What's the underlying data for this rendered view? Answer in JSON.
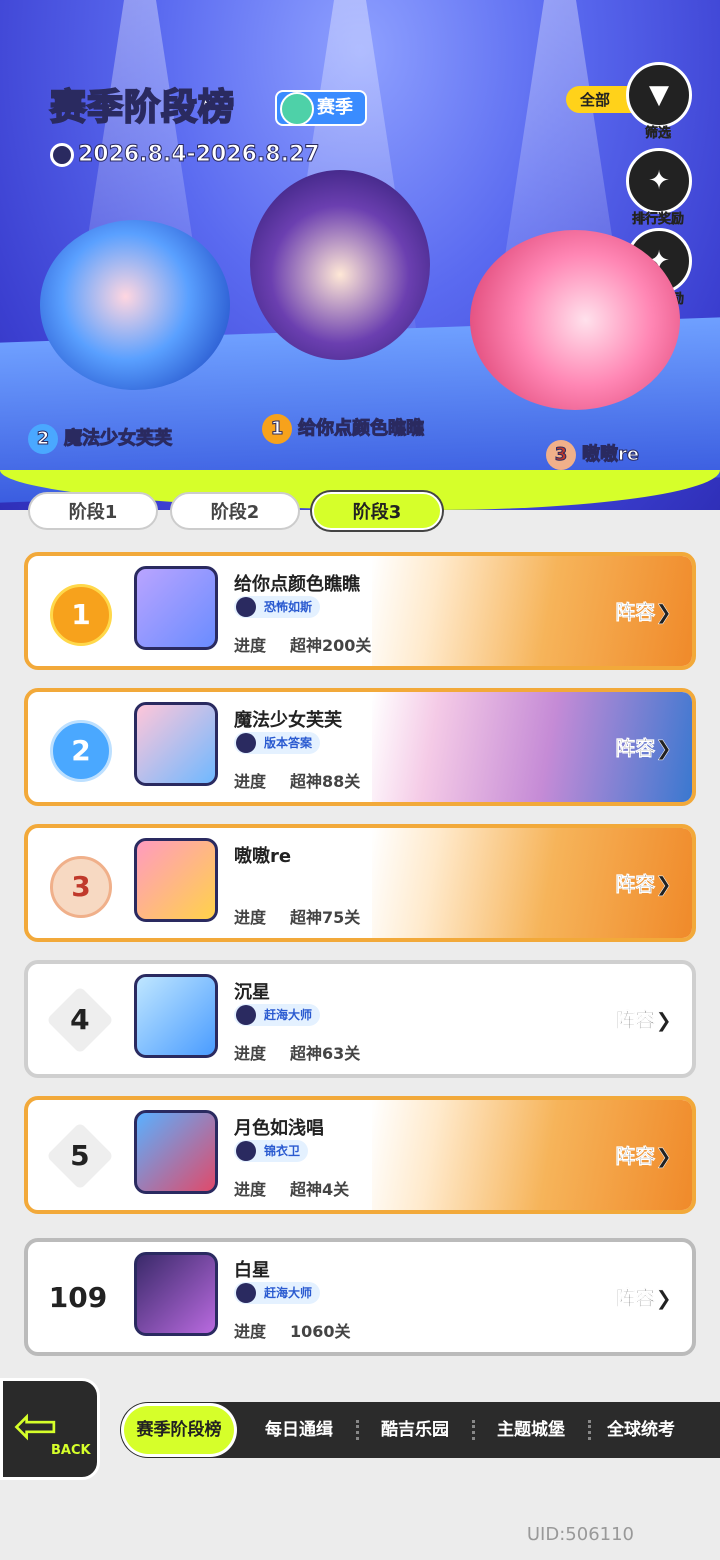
{
  "header": {
    "title": "赛季阶段榜",
    "season_tag": "赛季",
    "dates": "2026.8.4-2026.8.27"
  },
  "side_buttons": {
    "filter_all": "全部",
    "filter_label": "筛选",
    "rank_rewards": "排行奖励",
    "first_clear_rewards": "首通奖励"
  },
  "podium": {
    "first": {
      "rank": "1",
      "name": "给你点颜色瞧瞧"
    },
    "second": {
      "rank": "2",
      "name": "魔法少女芙芙"
    },
    "third": {
      "rank": "3",
      "name": "嗷嗷re"
    }
  },
  "stage_tabs": [
    {
      "label": "阶段1",
      "active": false
    },
    {
      "label": "阶段2",
      "active": false
    },
    {
      "label": "阶段3",
      "active": true
    }
  ],
  "rows": [
    {
      "rank": "1",
      "name": "给你点颜色瞧瞧",
      "title_badge": "恐怖如斯",
      "progress_label": "进度",
      "progress_value": "超神200关",
      "lineup": "阵容"
    },
    {
      "rank": "2",
      "name": "魔法少女芙芙",
      "title_badge": "版本答案",
      "progress_label": "进度",
      "progress_value": "超神88关",
      "lineup": "阵容"
    },
    {
      "rank": "3",
      "name": "嗷嗷re",
      "title_badge": "",
      "progress_label": "进度",
      "progress_value": "超神75关",
      "lineup": "阵容"
    },
    {
      "rank": "4",
      "name": "沉星",
      "title_badge": "赶海大师",
      "progress_label": "进度",
      "progress_value": "超神63关",
      "lineup": "阵容"
    },
    {
      "rank": "5",
      "name": "月色如浅唱",
      "title_badge": "锦衣卫",
      "progress_label": "进度",
      "progress_value": "超神4关",
      "lineup": "阵容"
    }
  ],
  "self_row": {
    "rank": "109",
    "name": "白星",
    "title_badge": "赶海大师",
    "progress_label": "进度",
    "progress_value": "1060关",
    "lineup": "阵容"
  },
  "back_button": {
    "label": "BACK"
  },
  "bottom_nav": [
    {
      "label": "赛季阶段榜",
      "active": true
    },
    {
      "label": "每日通缉",
      "active": false
    },
    {
      "label": "酷吉乐园",
      "active": false
    },
    {
      "label": "主题城堡",
      "active": false
    },
    {
      "label": "全球统考",
      "active": false
    }
  ],
  "uid": "UID:506110",
  "colors": {
    "accent": "#d6ff2a",
    "gold_border": "#f2a93a",
    "hero_bg": "#4a55e0"
  }
}
